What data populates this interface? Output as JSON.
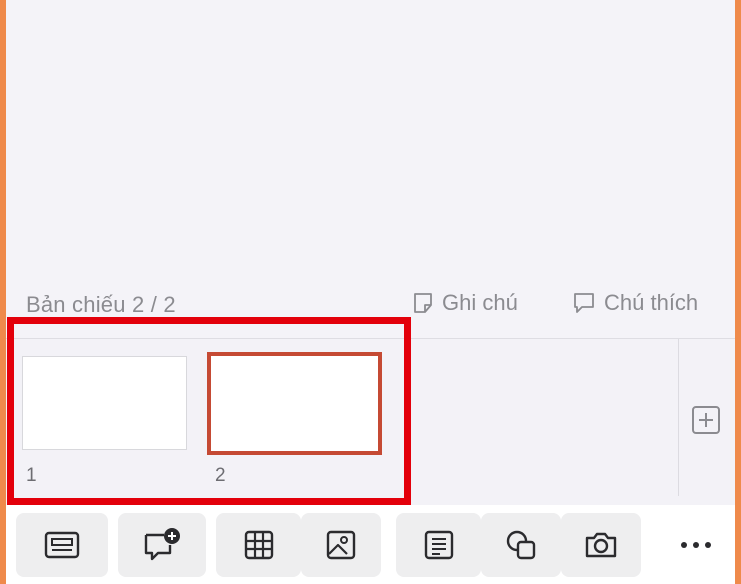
{
  "status": {
    "slide_counter": "Bản chiếu 2 / 2"
  },
  "notes_button": {
    "label": "Ghi chú",
    "icon": "note-icon"
  },
  "comments_button": {
    "label": "Chú thích",
    "icon": "comment-icon"
  },
  "thumbnails": [
    {
      "number": "1",
      "selected": false
    },
    {
      "number": "2",
      "selected": true
    }
  ],
  "add_slide": {
    "icon": "plus-square-icon"
  },
  "toolbar": {
    "items": [
      {
        "icon": "slide-layout-icon"
      },
      {
        "icon": "add-comment-icon"
      },
      {
        "icon": "table-icon"
      },
      {
        "icon": "picture-icon"
      },
      {
        "icon": "text-box-icon"
      },
      {
        "icon": "shapes-icon"
      },
      {
        "icon": "camera-icon"
      },
      {
        "icon": "more-icon"
      }
    ]
  },
  "colors": {
    "accent_orange": "#ef8a4b",
    "highlight_red": "#e3000b",
    "selected_thumb": "#c54a34",
    "icon_gray": "#8b8b90",
    "toolbar_icon": "#2b2b2e"
  }
}
